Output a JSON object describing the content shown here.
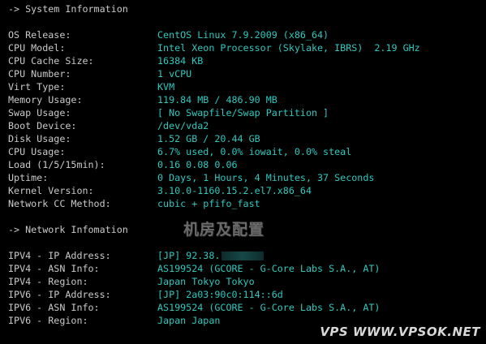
{
  "system": {
    "header": "-> System Information",
    "rows": [
      {
        "label": "OS Release:",
        "value": "CentOS Linux 7.9.2009 (x86_64)"
      },
      {
        "label": "CPU Model:",
        "value": "Intel Xeon Processor (Skylake, IBRS)  2.19 GHz"
      },
      {
        "label": "CPU Cache Size:",
        "value": "16384 KB"
      },
      {
        "label": "CPU Number:",
        "value": "1 vCPU"
      },
      {
        "label": "Virt Type:",
        "value": "KVM"
      },
      {
        "label": "Memory Usage:",
        "value": "119.84 MB / 486.90 MB"
      },
      {
        "label": "Swap Usage:",
        "value": "[ No Swapfile/Swap Partition ]"
      },
      {
        "label": "Boot Device:",
        "value": "/dev/vda2"
      },
      {
        "label": "Disk Usage:",
        "value": "1.52 GB / 20.44 GB"
      },
      {
        "label": "CPU Usage:",
        "value": "6.7% used, 0.0% iowait, 0.0% steal"
      },
      {
        "label": "Load (1/5/15min):",
        "value": "0.16 0.08 0.06"
      },
      {
        "label": "Uptime:",
        "value": "0 Days, 1 Hours, 4 Minutes, 37 Seconds"
      },
      {
        "label": "Kernel Version:",
        "value": "3.10.0-1160.15.2.el7.x86_64"
      },
      {
        "label": "Network CC Method:",
        "value": "cubic + pfifo_fast"
      }
    ]
  },
  "network": {
    "header": "-> Network Infomation",
    "rows": [
      {
        "label": "IPV4 - IP Address:",
        "value": "[JP] 92.38."
      },
      {
        "label": "IPV4 - ASN Info:",
        "value": "AS199524 (GCORE - G-Core Labs S.A., AT)"
      },
      {
        "label": "IPV4 - Region:",
        "value": "Japan Tokyo Tokyo"
      },
      {
        "label": "IPV6 - IP Address:",
        "value": "[JP] 2a03:90c0:114::6d"
      },
      {
        "label": "IPV6 - ASN Info:",
        "value": "AS199524 (GCORE - G-Core Labs S.A., AT)"
      },
      {
        "label": "IPV6 - Region:",
        "value": "Japan Japan"
      }
    ]
  },
  "watermark": {
    "center": "机房及配置",
    "corner": "VPS WWW.VPSOK.NET"
  },
  "colors": {
    "background": "#000000",
    "label": "#c9c9c9",
    "value": "#2ec8c0"
  }
}
